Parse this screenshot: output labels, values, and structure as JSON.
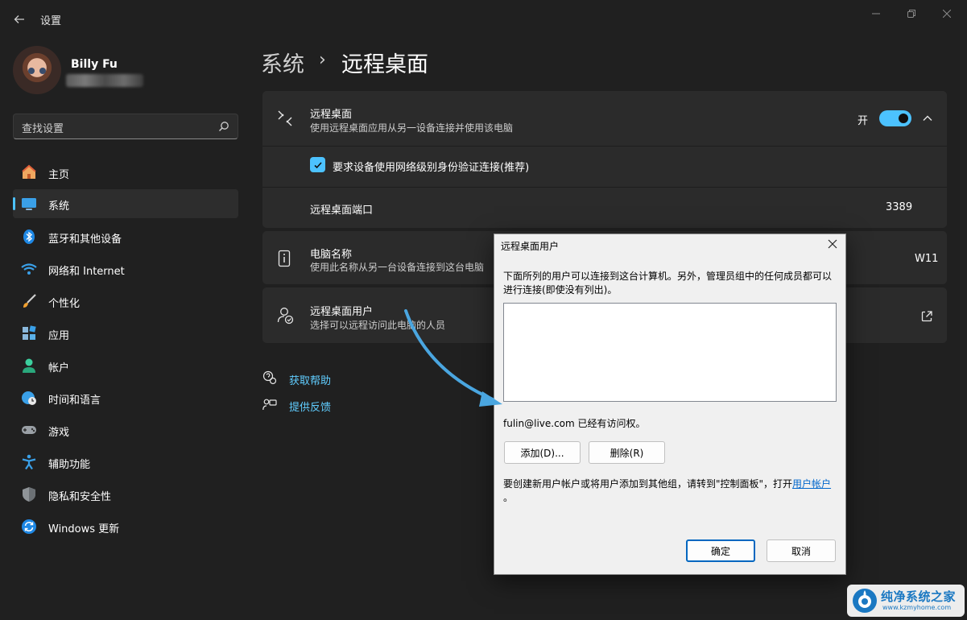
{
  "window": {
    "title": "设置",
    "back_icon": "back-arrow-icon",
    "controls": [
      "minimize-icon",
      "restore-icon",
      "close-icon"
    ]
  },
  "profile": {
    "name": "Billy Fu"
  },
  "search": {
    "placeholder": "查找设置",
    "icon": "search-icon"
  },
  "nav": [
    {
      "label": "主页",
      "icon": "home-icon"
    },
    {
      "label": "系统",
      "icon": "monitor-icon",
      "selected": true
    },
    {
      "label": "蓝牙和其他设备",
      "icon": "bluetooth-icon"
    },
    {
      "label": "网络和 Internet",
      "icon": "wifi-icon"
    },
    {
      "label": "个性化",
      "icon": "brush-icon"
    },
    {
      "label": "应用",
      "icon": "apps-icon"
    },
    {
      "label": "帐户",
      "icon": "account-icon"
    },
    {
      "label": "时间和语言",
      "icon": "globe-clock-icon"
    },
    {
      "label": "游戏",
      "icon": "gamepad-icon"
    },
    {
      "label": "辅助功能",
      "icon": "accessibility-icon"
    },
    {
      "label": "隐私和安全性",
      "icon": "shield-icon"
    },
    {
      "label": "Windows 更新",
      "icon": "update-icon"
    }
  ],
  "header": {
    "parent": "系统",
    "separator": "›",
    "current": "远程桌面"
  },
  "remote_desktop": {
    "title": "远程桌面",
    "description": "使用远程桌面应用从另一设备连接并使用该电脑",
    "toggle_label": "开",
    "toggle_on": true,
    "nla_label": "要求设备使用网络级别身份验证连接(推荐)",
    "nla_checked": true,
    "port_label": "远程桌面端口",
    "port_value": "3389"
  },
  "pc_name": {
    "title": "电脑名称",
    "description": "使用此名称从另一台设备连接到这台电脑",
    "value": "W11"
  },
  "rd_users": {
    "title": "远程桌面用户",
    "description": "选择可以远程访问此电脑的人员"
  },
  "help_links": {
    "help": "获取帮助",
    "feedback": "提供反馈"
  },
  "dialog": {
    "title": "远程桌面用户",
    "intro_line1": "下面所列的用户可以连接到这台计算机。另外，管理员组中的任何成员都可以",
    "intro_line2": "进行连接(即使没有列出)。",
    "access_text": "fulin@live.com 已经有访问权。",
    "add_button": "添加(D)...",
    "remove_button": "删除(R)",
    "note_text": "要创建新用户帐户或将用户添加到其他组，请转到\"控制面板\"，打开",
    "note_link": "用户帐户",
    "note_end": "。",
    "ok_button": "确定",
    "cancel_button": "取消"
  },
  "watermark": {
    "name": "纯净系统之家",
    "url": "www.kzmyhome.com"
  },
  "colors": {
    "accent": "#4cc2ff",
    "background": "#202020",
    "card": "#2b2b2b",
    "link": "#60cdff",
    "annotation_arrow": "#4aa6e0"
  }
}
